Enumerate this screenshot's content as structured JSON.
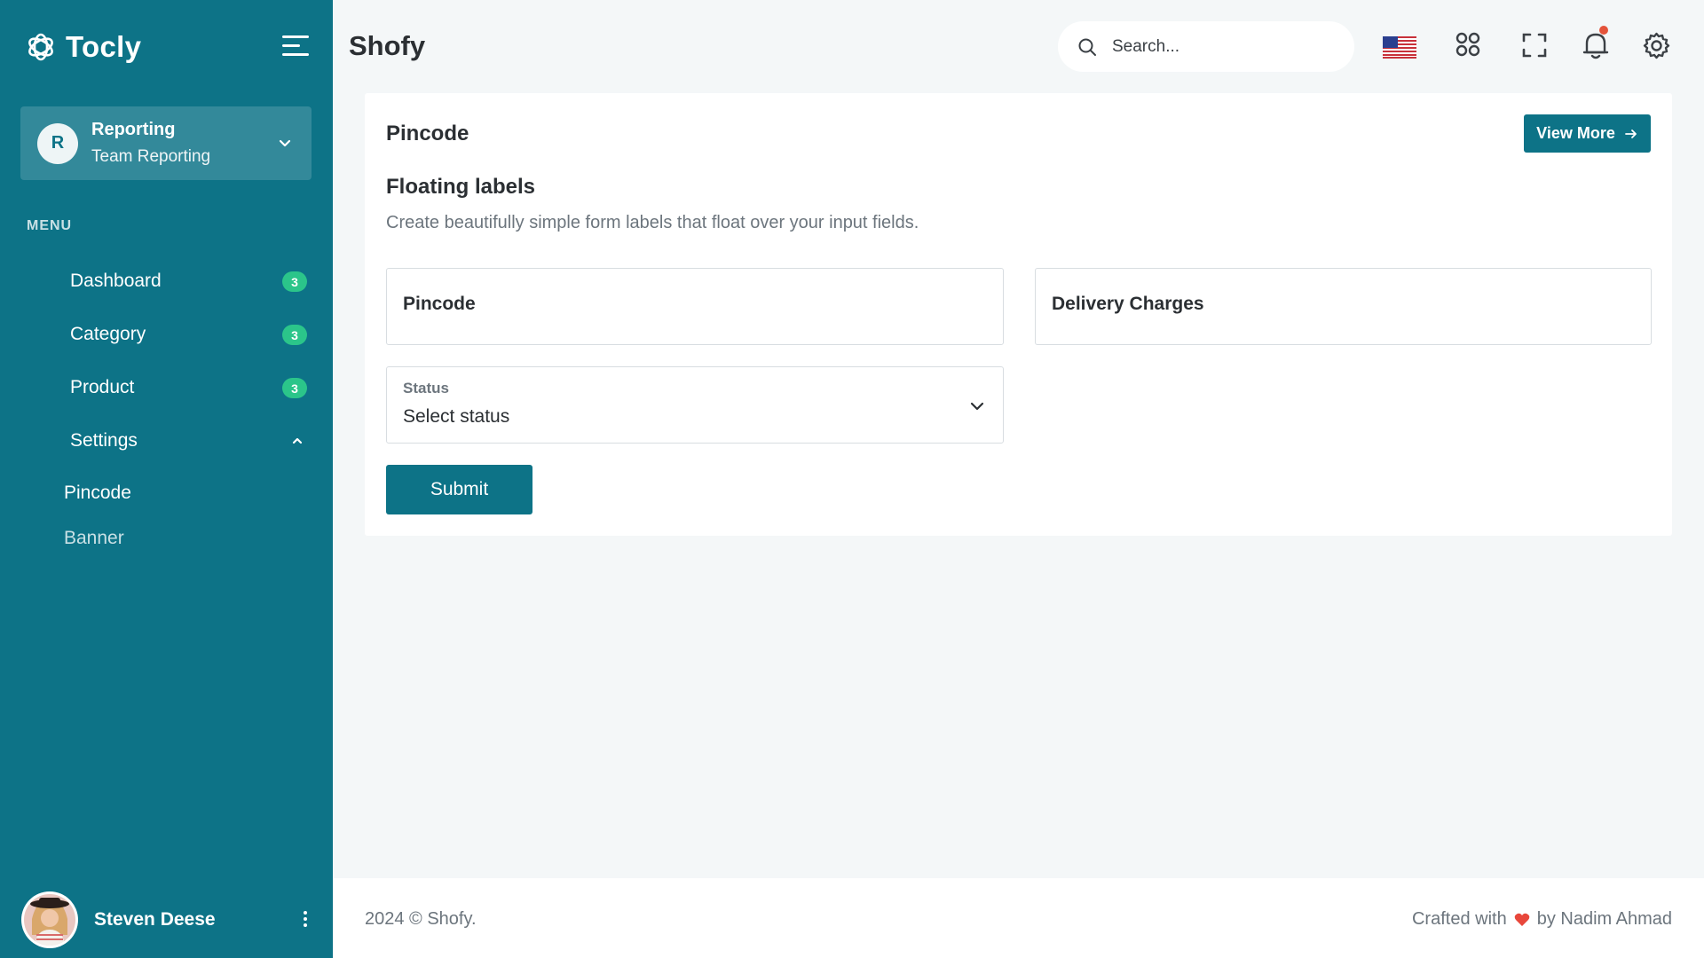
{
  "colors": {
    "sidebar_bg": "#0d7387",
    "accent": "#0d7387",
    "badge_green": "#2bc58a",
    "notification_dot": "#e4533a",
    "heart": "#e8473b"
  },
  "sidebar": {
    "brand": "Tocly",
    "brand_icon": "tocly-logo-icon",
    "team": {
      "avatar_letter": "R",
      "name": "Reporting",
      "subtitle": "Team Reporting"
    },
    "menu_label": "MENU",
    "items": [
      {
        "label": "Dashboard",
        "badge": "3"
      },
      {
        "label": "Category",
        "badge": "3"
      },
      {
        "label": "Product",
        "badge": "3"
      },
      {
        "label": "Settings",
        "expanded": true
      }
    ],
    "sub_items": [
      {
        "label": "Pincode",
        "active": true
      },
      {
        "label": "Banner",
        "active": false
      }
    ],
    "user": {
      "name": "Steven Deese"
    }
  },
  "header": {
    "title": "Shofy",
    "search_placeholder": "Search...",
    "icons": [
      "us-flag-icon",
      "apps-grid-icon",
      "fullscreen-icon",
      "bell-icon",
      "gear-icon"
    ]
  },
  "card": {
    "title": "Pincode",
    "view_more_label": "View More",
    "section_title": "Floating labels",
    "section_desc": "Create beautifully simple form labels that float over your input fields.",
    "fields": {
      "pincode_label": "Pincode",
      "delivery_label": "Delivery Charges",
      "status_label": "Status",
      "status_value": "Select status"
    },
    "submit_label": "Submit"
  },
  "footer": {
    "copyright": "2024 © Shofy.",
    "crafted_prefix": "Crafted with",
    "crafted_suffix": "by Nadim Ahmad"
  }
}
